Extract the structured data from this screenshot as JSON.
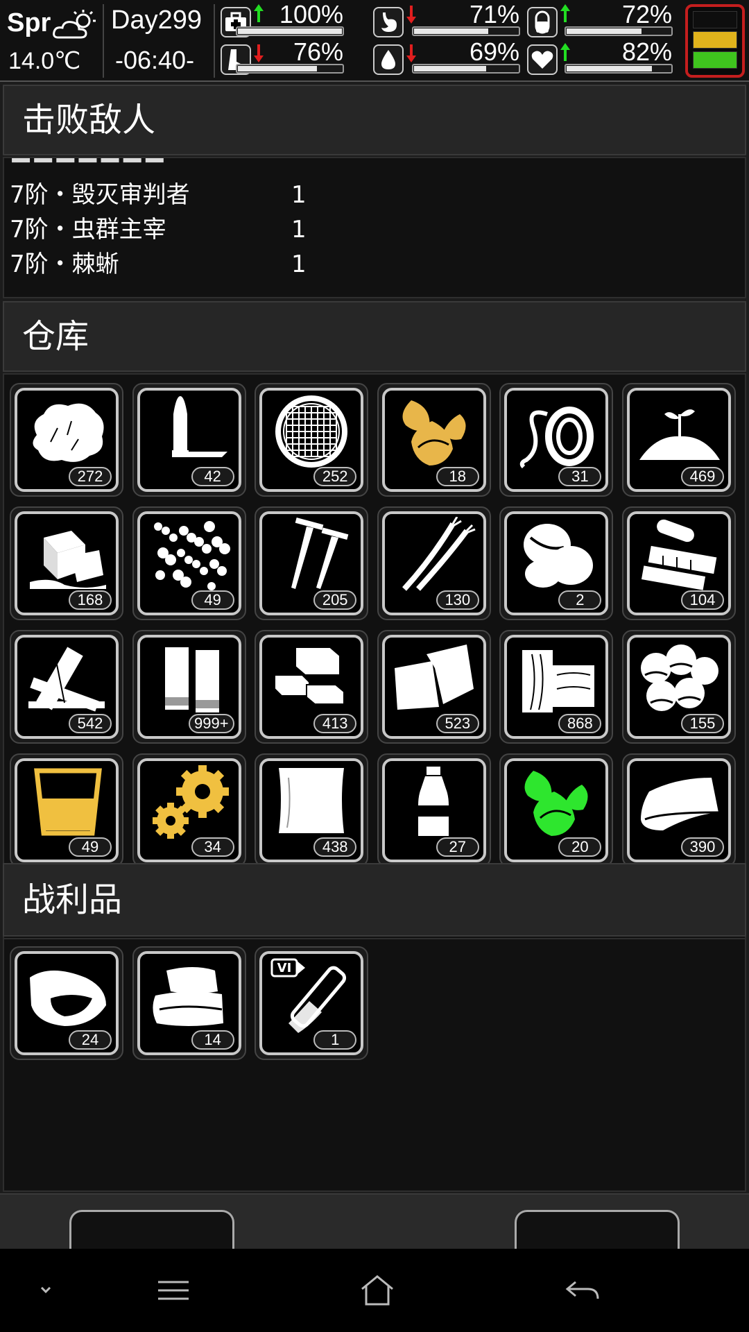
{
  "status": {
    "season": "Spr",
    "temperature": "14.0℃",
    "day": "Day299",
    "time": "-06:40-",
    "weather_icon": "partly-cloudy-icon",
    "gauges": [
      {
        "name": "health",
        "icon": "first-aid-icon",
        "trend": "up",
        "percent": "100%",
        "level": 1.0
      },
      {
        "name": "hunger",
        "icon": "stomach-icon",
        "trend": "down",
        "percent": "71%",
        "level": 0.71
      },
      {
        "name": "energy",
        "icon": "capsule-icon",
        "trend": "up",
        "percent": "72%",
        "level": 0.72
      },
      {
        "name": "stamina",
        "icon": "foot-icon",
        "trend": "down",
        "percent": "76%",
        "level": 0.76
      },
      {
        "name": "thirst",
        "icon": "water-drop-icon",
        "trend": "down",
        "percent": "69%",
        "level": 0.69
      },
      {
        "name": "mood",
        "icon": "heart-icon",
        "trend": "up",
        "percent": "82%",
        "level": 0.82
      }
    ],
    "colors": {
      "up": "#22dd22",
      "down": "#e01e1e",
      "battery_border": "#c41e1e",
      "battery_mid": "#e0b31c",
      "battery_low": "#3fc41e"
    }
  },
  "defeated": {
    "title": "击败敌人",
    "rows": [
      {
        "name": "7阶・毁灭审判者",
        "count": "1"
      },
      {
        "name": "7阶・虫群主宰",
        "count": "1"
      },
      {
        "name": "7阶・棘蜥",
        "count": "1"
      }
    ]
  },
  "warehouse": {
    "title": "仓库",
    "items": [
      {
        "icon": "cotton-icon",
        "count": "272",
        "color": "#ffffff"
      },
      {
        "icon": "bullet-icon",
        "count": "42",
        "color": "#ffffff"
      },
      {
        "icon": "mesh-filter-icon",
        "count": "252",
        "color": "#ffffff"
      },
      {
        "icon": "tobacco-leaf-icon",
        "count": "18",
        "color": "#e8b64a"
      },
      {
        "icon": "rope-icon",
        "count": "31",
        "color": "#ffffff"
      },
      {
        "icon": "soil-sprout-icon",
        "count": "469",
        "color": "#ffffff"
      },
      {
        "icon": "ice-cube-icon",
        "count": "168",
        "color": "#ffffff"
      },
      {
        "icon": "pellets-icon",
        "count": "49",
        "color": "#ffffff"
      },
      {
        "icon": "nails-icon",
        "count": "205",
        "color": "#ffffff"
      },
      {
        "icon": "wires-icon",
        "count": "130",
        "color": "#ffffff"
      },
      {
        "icon": "coffee-beans-icon",
        "count": "2",
        "color": "#ffffff"
      },
      {
        "icon": "electronic-parts-icon",
        "count": "104",
        "color": "#ffffff"
      },
      {
        "icon": "wooden-planks-icon",
        "count": "542",
        "color": "#ffffff"
      },
      {
        "icon": "cloth-strips-icon",
        "count": "999+",
        "color": "#ffffff"
      },
      {
        "icon": "bricks-icon",
        "count": "413",
        "color": "#ffffff"
      },
      {
        "icon": "leather-icon",
        "count": "523",
        "color": "#ffffff"
      },
      {
        "icon": "wood-blocks-icon",
        "count": "868",
        "color": "#ffffff"
      },
      {
        "icon": "chestnuts-icon",
        "count": "155",
        "color": "#ffffff"
      },
      {
        "icon": "beaker-icon",
        "count": "49",
        "color": "#f0c040"
      },
      {
        "icon": "gears-icon",
        "count": "34",
        "color": "#f0c040"
      },
      {
        "icon": "paper-sheets-icon",
        "count": "438",
        "color": "#ffffff"
      },
      {
        "icon": "plastic-bottle-icon",
        "count": "27",
        "color": "#ffffff"
      },
      {
        "icon": "herb-leaf-icon",
        "count": "20",
        "color": "#2ee62e"
      },
      {
        "icon": "folded-cloth-icon",
        "count": "390",
        "color": "#ffffff"
      }
    ]
  },
  "loot": {
    "title": "战利品",
    "items": [
      {
        "icon": "meat-chunk-icon",
        "count": "24",
        "color": "#ffffff"
      },
      {
        "icon": "folded-towels-icon",
        "count": "14",
        "color": "#ffffff"
      },
      {
        "icon": "test-tube-icon",
        "count": "1",
        "color": "#ffffff",
        "tag": "VI"
      }
    ]
  },
  "nav": {
    "icons": [
      "chevron-down-icon",
      "menu-icon",
      "home-icon",
      "back-icon"
    ]
  }
}
